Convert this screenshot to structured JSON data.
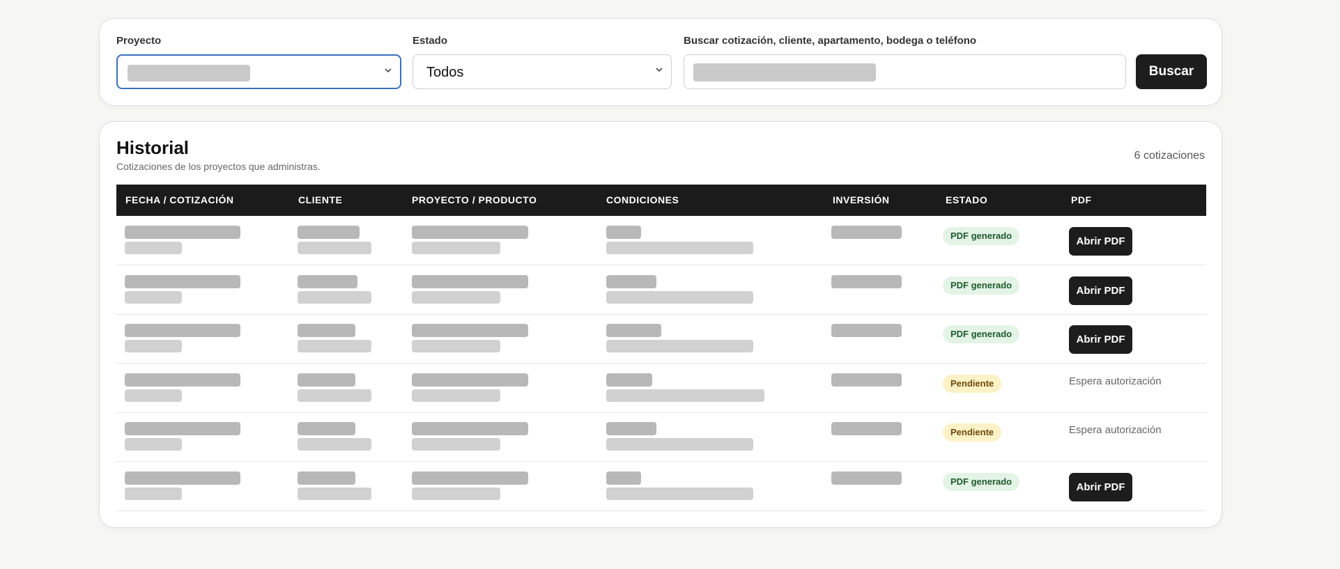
{
  "filters": {
    "project_label": "Proyecto",
    "status_label": "Estado",
    "status_value": "Todos",
    "search_label": "Buscar cotización, cliente, apartamento, bodega o teléfono",
    "search_button": "Buscar"
  },
  "history": {
    "title": "Historial",
    "subtitle": "Cotizaciones de los proyectos que administras.",
    "count": "6 cotizaciones",
    "columns": [
      "FECHA / COTIZACIÓN",
      "CLIENTE",
      "PROYECTO / PRODUCTO",
      "CONDICIONES",
      "INVERSIÓN",
      "ESTADO",
      "PDF"
    ],
    "rows": [
      {
        "status": "PDF generado",
        "state": "ok",
        "pdf": "Abrir PDF"
      },
      {
        "status": "PDF generado",
        "state": "ok",
        "pdf": "Abrir PDF"
      },
      {
        "status": "PDF generado",
        "state": "ok",
        "pdf": "Abrir PDF"
      },
      {
        "status": "Pendiente",
        "state": "pending",
        "pdf": "Espera autorización"
      },
      {
        "status": "Pendiente",
        "state": "pending",
        "pdf": "Espera autorización"
      },
      {
        "status": "PDF generado",
        "state": "ok",
        "pdf": "Abrir PDF"
      }
    ]
  },
  "colors": {
    "accent_focus": "#3b6fbe",
    "button_dark": "#1d1d1d",
    "badge_ok_bg": "#e3f4e6",
    "badge_pending_bg": "#fdf1c7"
  }
}
